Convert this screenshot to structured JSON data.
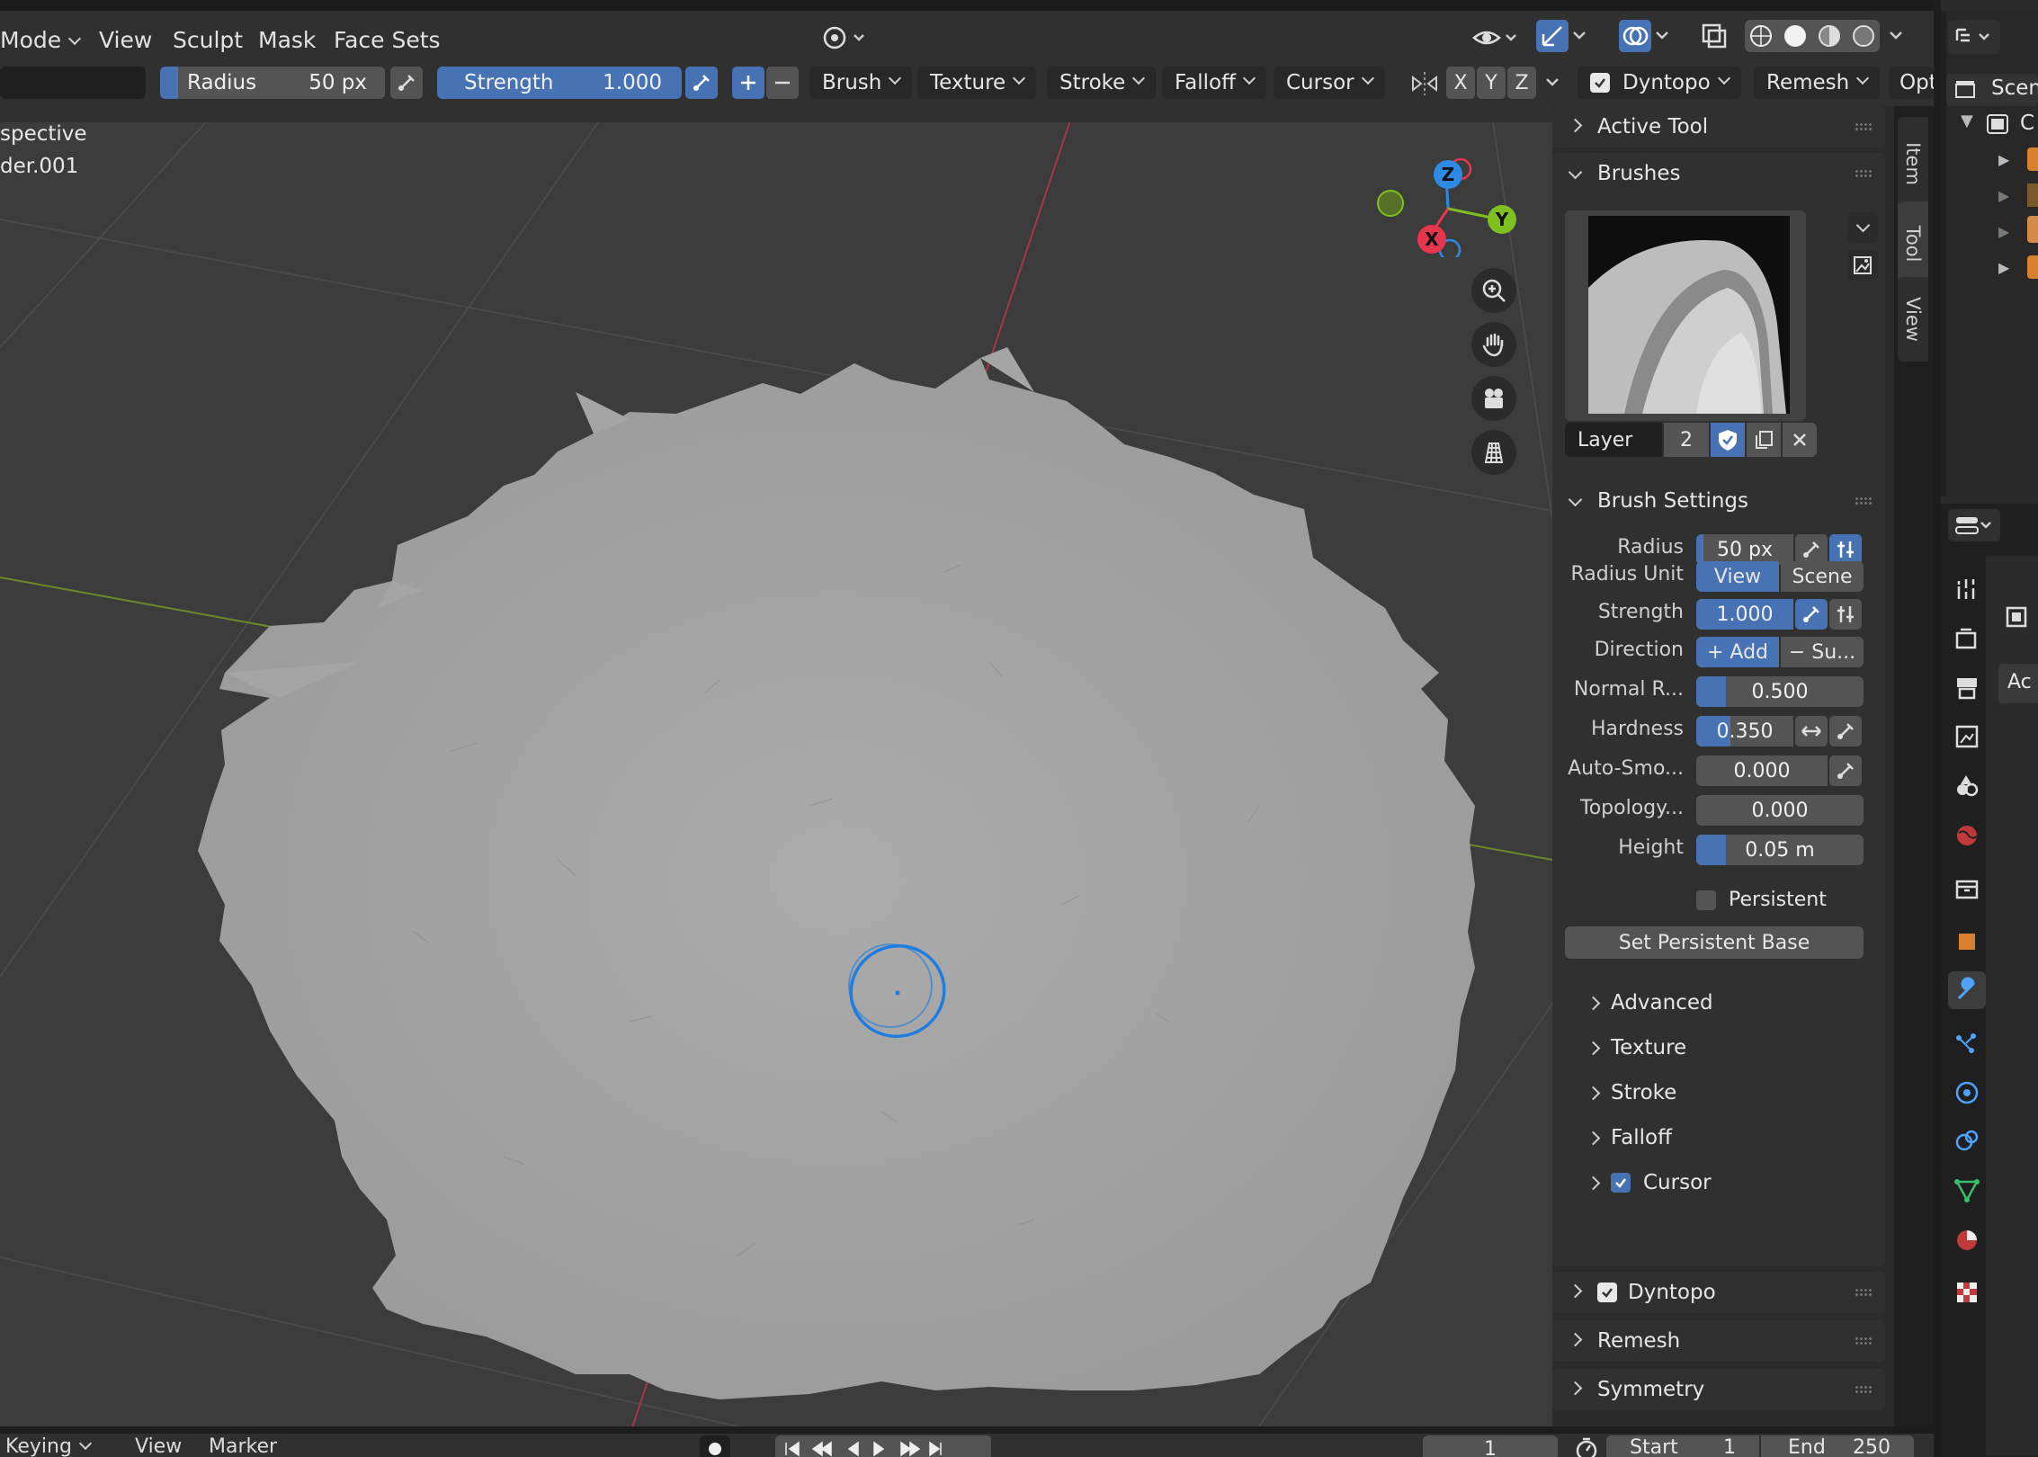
{
  "header": {
    "mode": "Mode",
    "menus": [
      "View",
      "Sculpt",
      "Mask",
      "Face Sets"
    ]
  },
  "toolbar": {
    "radius_label": "Radius",
    "radius_value": "50 px",
    "strength_label": "Strength",
    "strength_value": "1.000",
    "menus": [
      "Brush",
      "Texture",
      "Stroke",
      "Falloff",
      "Cursor"
    ],
    "axes": [
      "X",
      "Y",
      "Z"
    ],
    "dyntopo": "Dyntopo",
    "remesh": "Remesh",
    "options": "Opt"
  },
  "viewport": {
    "view_label": "spective",
    "object_label": "der.001",
    "gizmo": {
      "x": "X",
      "y": "Y",
      "z": "Z"
    }
  },
  "sidebar_tabs": [
    "Item",
    "Tool",
    "View"
  ],
  "npanel": {
    "active_tool": "Active Tool",
    "brushes": "Brushes",
    "brush_name": "Layer",
    "brush_users": "2",
    "brush_settings": "Brush Settings",
    "radius_label": "Radius",
    "radius_value": "50 px",
    "radius_unit_label": "Radius Unit",
    "radius_unit_view": "View",
    "radius_unit_scene": "Scene",
    "strength_label": "Strength",
    "strength_value": "1.000",
    "direction_label": "Direction",
    "direction_add": "+ Add",
    "direction_sub": "− Su...",
    "normal_label": "Normal R...",
    "normal_value": "0.500",
    "normal_fraction": 0.18,
    "hardness_label": "Hardness",
    "hardness_value": "0.350",
    "autosmooth_label": "Auto-Smo...",
    "autosmooth_value": "0.000",
    "topology_label": "Topology...",
    "topology_value": "0.000",
    "height_label": "Height",
    "height_value": "0.05 m",
    "height_fraction": 0.18,
    "persistent": "Persistent",
    "set_persistent_base": "Set Persistent Base",
    "subpanels": [
      "Advanced",
      "Texture",
      "Stroke",
      "Falloff",
      "Cursor"
    ],
    "dyntopo": "Dyntopo",
    "remesh": "Remesh",
    "symmetry": "Symmetry"
  },
  "outliner": {
    "scene": "Scen",
    "collection": "C"
  },
  "properties": {
    "active": "Ac"
  },
  "timeline": {
    "keying": "Keying",
    "view": "View",
    "marker": "Marker",
    "current_frame": "1",
    "start_label": "Start",
    "start_value": "1",
    "end_label": "End",
    "end_value": "250"
  },
  "colors": {
    "accent": "#4772b3",
    "x_axis": "#e8354e",
    "y_axis": "#7fbf1f",
    "z_axis": "#2e8ae6",
    "brush_cursor": "#1e7de0"
  }
}
